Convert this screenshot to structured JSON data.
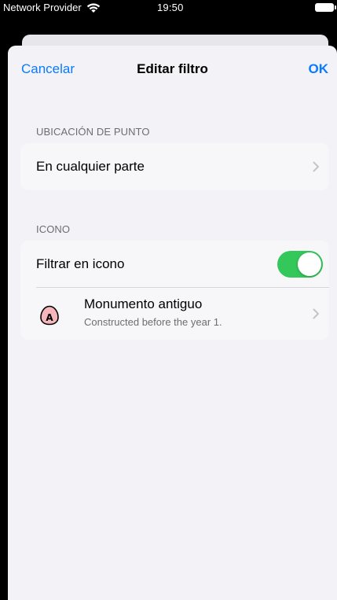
{
  "status_bar": {
    "carrier": "Network Provider",
    "time": "19:50"
  },
  "navbar": {
    "cancel_label": "Cancelar",
    "title": "Editar filtro",
    "ok_label": "OK"
  },
  "location_section": {
    "header": "UBICACIÓN DE PUNTO",
    "value": "En cualquier parte"
  },
  "icon_section": {
    "header": "ICONO",
    "filter_label": "Filtrar en icono",
    "filter_enabled": true,
    "icon_title": "Monumento antiguo",
    "icon_subtitle": "Constructed before the year 1.",
    "icon_letter": "A"
  },
  "colors": {
    "accent": "#0a7aff",
    "toggle_on": "#34c759",
    "icon_fill": "#f5b7bb"
  }
}
